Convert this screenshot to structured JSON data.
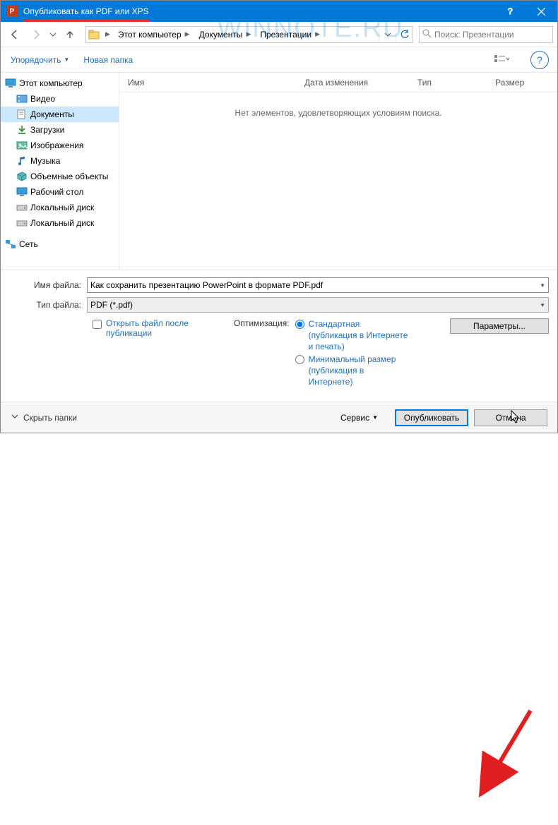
{
  "window": {
    "title": "Опубликовать как PDF или XPS",
    "app_icon_letter": "P",
    "watermark": "WINNOTE.RU"
  },
  "nav": {
    "breadcrumbs": [
      "Этот компьютер",
      "Документы",
      "Презентации"
    ],
    "search_placeholder": "Поиск: Презентации"
  },
  "toolbar": {
    "organize": "Упорядочить",
    "new_folder": "Новая папка"
  },
  "tree": {
    "root": "Этот компьютер",
    "items": [
      {
        "label": "Видео",
        "icon": "video"
      },
      {
        "label": "Документы",
        "icon": "doc",
        "selected": true
      },
      {
        "label": "Загрузки",
        "icon": "download"
      },
      {
        "label": "Изображения",
        "icon": "image"
      },
      {
        "label": "Музыка",
        "icon": "music"
      },
      {
        "label": "Объемные объекты",
        "icon": "3d"
      },
      {
        "label": "Рабочий стол",
        "icon": "desktop"
      },
      {
        "label": "Локальный диск",
        "icon": "disk"
      },
      {
        "label": "Локальный диск",
        "icon": "disk"
      }
    ],
    "network": "Сеть"
  },
  "columns": {
    "name": "Имя",
    "date": "Дата изменения",
    "type": "Тип",
    "size": "Размер"
  },
  "list": {
    "empty_text": "Нет элементов, удовлетворяющих условиям поиска."
  },
  "form": {
    "filename_label": "Имя файла:",
    "filename_value": "Как сохранить презентацию PowerPoint в формате PDF.pdf",
    "filetype_label": "Тип файла:",
    "filetype_value": "PDF (*.pdf)",
    "open_after": "Открыть файл после публикации",
    "optimization_label": "Оптимизация:",
    "opt_standard": "Стандартная (публикация в Интернете и печать)",
    "opt_minimal": "Минимальный размер (публикация в Интернете)",
    "options_button": "Параметры..."
  },
  "footer": {
    "hide_folders": "Скрыть папки",
    "service": "Сервис",
    "publish": "Опубликовать",
    "cancel": "Отмена"
  }
}
